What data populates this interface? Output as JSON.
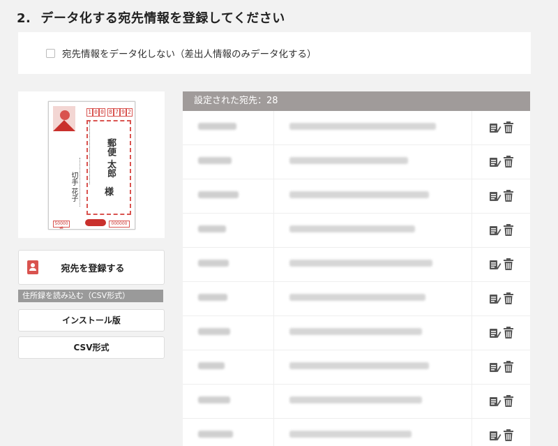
{
  "section": {
    "number": "2.",
    "title": "データ化する宛先情報を登録してください"
  },
  "option": {
    "checkbox_label": "宛先情報をデータ化しない（差出人情報のみデータ化する）",
    "checked": false
  },
  "postcard": {
    "zip": [
      "1",
      "0",
      "0",
      "8",
      "7",
      "9",
      "2"
    ],
    "recipient_name": "郵便 太郎",
    "recipient_suffix": "様",
    "sender_name": "切手 花子",
    "lottery_left": "50000番",
    "lottery_right": "000000"
  },
  "register_button": {
    "label": "宛先を登録する",
    "icon": "address-book-icon"
  },
  "csv_section": {
    "header": "住所録を読み込む（CSV形式）",
    "install_label": "インストール版",
    "csv_label": "CSV形式"
  },
  "list": {
    "header": "設定された宛先：28",
    "rows": 10,
    "icons": {
      "edit": "edit-icon",
      "delete": "trash-icon"
    }
  },
  "colors": {
    "accent_red": "#d9534f",
    "list_header": "#a09b9a",
    "icon_gray": "#555555"
  }
}
